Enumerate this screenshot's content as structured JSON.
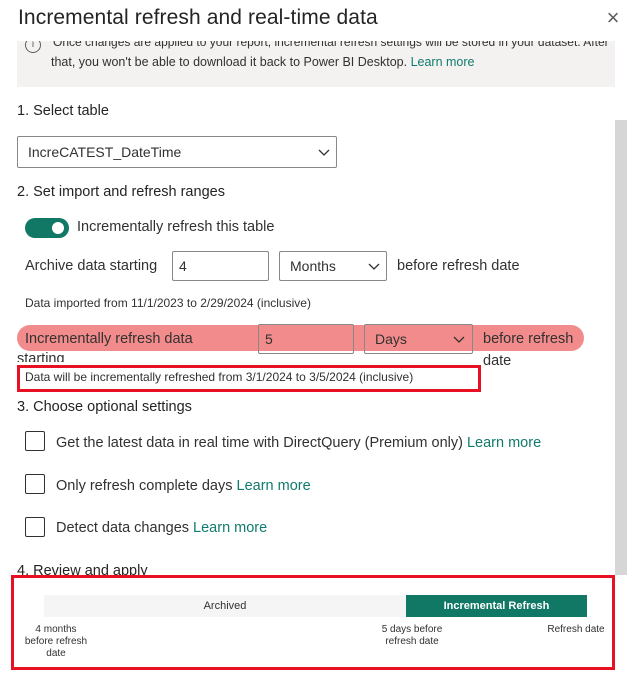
{
  "dialog": {
    "title": "Incremental refresh and real-time data",
    "close_glyph": "×",
    "info": {
      "icon": "info-icon",
      "line1": "Once changes are applied to your report, incremental refresh settings will be stored in your dataset. After",
      "line2": "that, you won't be able to download it back to Power BI Desktop.",
      "learn_more": "Learn more"
    }
  },
  "select_table": {
    "heading": "1. Select table",
    "value": "IncreCATEST_DateTime"
  },
  "ranges": {
    "heading": "2. Set import and refresh ranges",
    "toggle_label": "Incrementally refresh this table",
    "toggle_on": true,
    "archive": {
      "label": "Archive data starting",
      "value": "4",
      "unit": "Months",
      "suffix": "before refresh date"
    },
    "imported_note": "Data imported from 11/1/2023 to 2/29/2024 (inclusive)",
    "incremental": {
      "label_line1": "Incrementally refresh data",
      "label_line2": "starting",
      "value": "5",
      "unit": "Days",
      "suffix_line1": "before refresh",
      "suffix_line2": "date"
    },
    "refreshed_note": "Data will be incrementally refreshed from 3/1/2024 to 3/5/2024 (inclusive)"
  },
  "optional": {
    "heading": "3. Choose optional settings",
    "items": [
      {
        "label": "Get the latest data in real time with DirectQuery (Premium only)",
        "link": "Learn more",
        "checked": false
      },
      {
        "label": "Only refresh complete days",
        "link": "Learn more",
        "checked": false
      },
      {
        "label": "Detect data changes",
        "link": "Learn more",
        "checked": false
      }
    ]
  },
  "review": {
    "heading": "4. Review and apply",
    "archived_label": "Archived",
    "incremental_label": "Incremental Refresh",
    "tick_left": [
      "4 months",
      "before refresh",
      "date"
    ],
    "tick_mid": [
      "5 days before",
      "refresh date"
    ],
    "tick_right": "Refresh date"
  },
  "colors": {
    "accent": "#117865",
    "highlight": "#f28c8c",
    "annotation_red": "#e81123"
  }
}
